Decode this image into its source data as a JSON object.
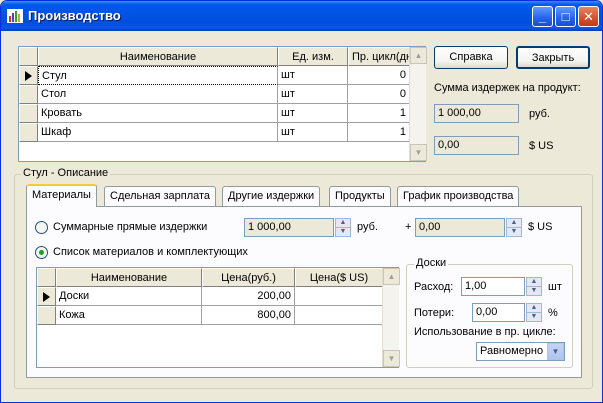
{
  "window": {
    "title": "Производство",
    "minimize_glyph": "_",
    "maximize_glyph": "□",
    "close_glyph": "✕",
    "app_icon": "chart-icon"
  },
  "products": {
    "columns": [
      "Наименование",
      "Ед. изм.",
      "Пр. цикл(дн.)"
    ],
    "rows": [
      {
        "name": "Стул",
        "unit": "шт",
        "cycle": "0",
        "selected": true
      },
      {
        "name": "Стол",
        "unit": "шт",
        "cycle": "0"
      },
      {
        "name": "Кровать",
        "unit": "шт",
        "cycle": "1"
      },
      {
        "name": "Шкаф",
        "unit": "шт",
        "cycle": "1"
      }
    ]
  },
  "buttons": {
    "help": "Справка",
    "close": "Закрыть"
  },
  "cost_summary": {
    "label": "Сумма издержек на продукт:",
    "rub_value": "1 000,00",
    "rub_unit": "руб.",
    "usd_value": "0,00",
    "usd_unit": "$ US"
  },
  "description_group": {
    "title": "Стул - Описание"
  },
  "tabs": [
    {
      "label": "Материалы",
      "active": true
    },
    {
      "label": "Сдельная зарплата"
    },
    {
      "label": "Другие издержки"
    },
    {
      "label": "Продукты"
    },
    {
      "label": "График производства"
    }
  ],
  "materials": {
    "radio_total_label": "Суммарные прямые издержки",
    "total_rub_value": "1 000,00",
    "total_rub_unit": "руб.",
    "plus": "+",
    "total_usd_value": "0,00",
    "total_usd_unit": "$ US",
    "radio_list_label": "Список материалов и комплектующих",
    "selected_radio": "list",
    "columns": [
      "Наименование",
      "Цена(руб.)",
      "Цена($ US)"
    ],
    "rows": [
      {
        "name": "Доски",
        "price_rub": "200,00",
        "price_usd": "",
        "selected": true
      },
      {
        "name": "Кожа",
        "price_rub": "800,00",
        "price_usd": ""
      }
    ]
  },
  "material_detail": {
    "title": "Доски",
    "consumption_label": "Расход:",
    "consumption_value": "1,00",
    "consumption_unit": "шт",
    "loss_label": "Потери:",
    "loss_value": "0,00",
    "loss_unit": "%",
    "usage_label": "Использование в пр. цикле:",
    "usage_value": "Равномерно"
  }
}
